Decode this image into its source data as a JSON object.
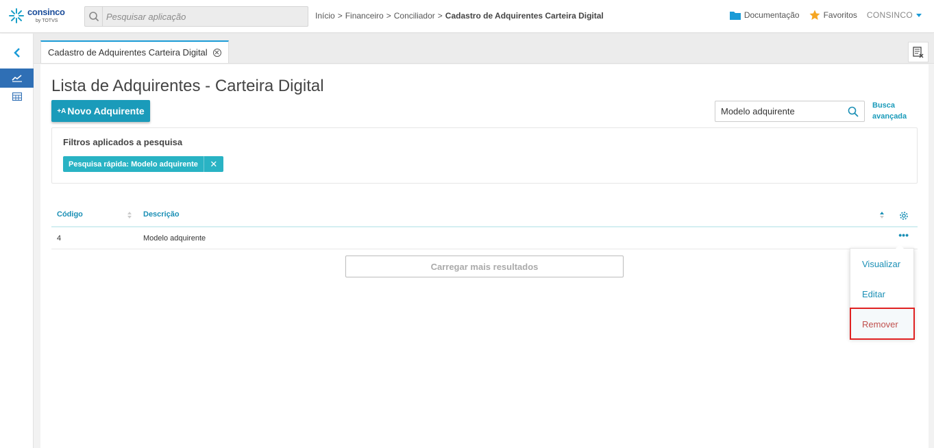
{
  "header": {
    "logo_brand": "consinco",
    "logo_sub": "by TOTVS",
    "search_placeholder": "Pesquisar aplicação",
    "breadcrumb": [
      "Início",
      "Financeiro",
      "Conciliador",
      "Cadastro de Adquirentes Carteira Digital"
    ],
    "breadcrumb_separator": ">",
    "documentation_label": "Documentação",
    "favorites_label": "Favoritos",
    "user_label": "CONSINCO"
  },
  "tab": {
    "label": "Cadastro de Adquirentes Carteira Digital"
  },
  "page": {
    "title": "Lista de Adquirentes - Carteira Digital",
    "new_button_prefix": "+A",
    "new_button_label": "Novo Adquirente",
    "quick_search_value": "Modelo adquirente",
    "advanced_search_label": "Busca avançada"
  },
  "filters": {
    "title": "Filtros aplicados a pesquisa",
    "chips": [
      {
        "label": "Pesquisa rápida: Modelo adquirente",
        "remove": "✕"
      }
    ]
  },
  "table": {
    "columns": [
      "Código",
      "Descrição"
    ],
    "rows": [
      {
        "codigo": "4",
        "descricao": "Modelo adquirente"
      }
    ],
    "row_actions_icon": "•••",
    "load_more_label": "Carregar mais resultados"
  },
  "row_menu": {
    "items": [
      "Visualizar",
      "Editar",
      "Remover"
    ]
  },
  "colors": {
    "accent": "#1a9bba",
    "link": "#1a8fb5",
    "chip": "#29b3c4",
    "danger_text": "#c0504d",
    "highlight": "#e02020"
  }
}
